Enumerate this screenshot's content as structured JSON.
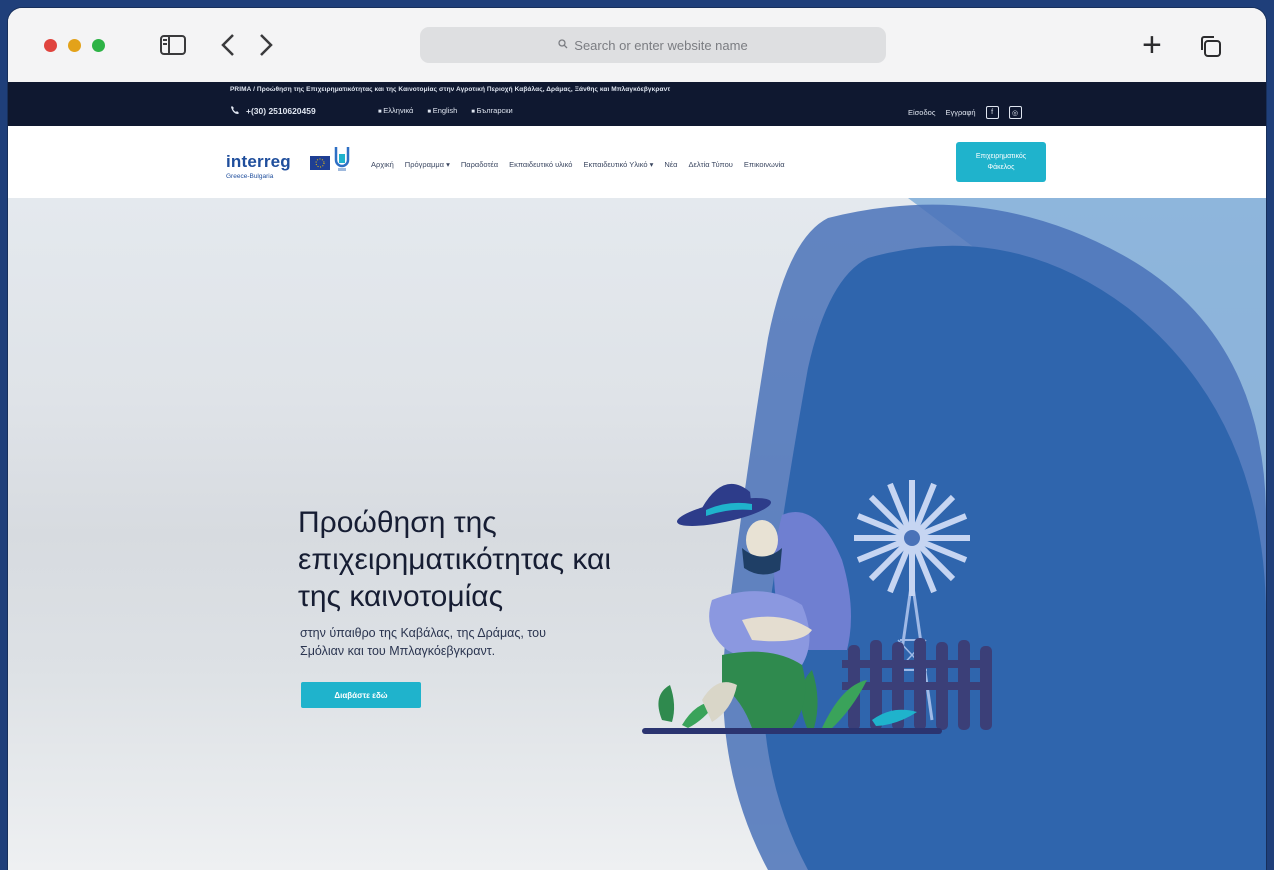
{
  "browser": {
    "url_placeholder": "Search or enter website name"
  },
  "topbar": {
    "project_title": "PRIMA / Προώθηση της Επιχειρηματικότητας και της Καινοτομίας στην Αγροτική Περιοχή Καβάλας, Δράμας, Ξάνθης και Μπλαγκόεβγκραντ",
    "phone": "+(30) 2510620459",
    "languages": [
      "Ελληνικά",
      "English",
      "Български"
    ],
    "login": "Είσοδος",
    "register": "Εγγραφή"
  },
  "nav": {
    "logo_word": "interreg",
    "logo_sub": "Greece-Bulgaria",
    "items": [
      "Αρχική",
      "Πρόγραμμα ▾",
      "Παραδοτέα",
      "Εκπαιδευτικό υλικό",
      "Εκπαιδευτικό Υλικό ▾",
      "Νέα",
      "Δελτία Τύπου",
      "Επικοινωνία"
    ],
    "cta_line1": "Επιχειρηματικός",
    "cta_line2": "Φάκελος"
  },
  "hero": {
    "title_lines": [
      "Προώθηση της",
      "επιχειρηματικότητας και",
      "της καινοτομίας"
    ],
    "subtitle_line1": "στην ύπαιθρο της Καβάλας, της Δράμας, του",
    "subtitle_line2": "Σμόλιαν και του Μπλαγκόεβγκραντ.",
    "button": "Διαβάστε εδώ"
  },
  "colors": {
    "accent": "#1fb3cc",
    "topbar": "#0f1830",
    "blob_primary": "#2f65ad",
    "brand": "#1f4e9c"
  },
  "icons": [
    "sidebar-icon",
    "chevron-left-icon",
    "chevron-right-icon",
    "search-icon",
    "plus-icon",
    "tabs-icon",
    "phone-icon",
    "flag-icon",
    "facebook-icon",
    "instagram-icon",
    "farmer-illustration",
    "windmill-illustration"
  ]
}
